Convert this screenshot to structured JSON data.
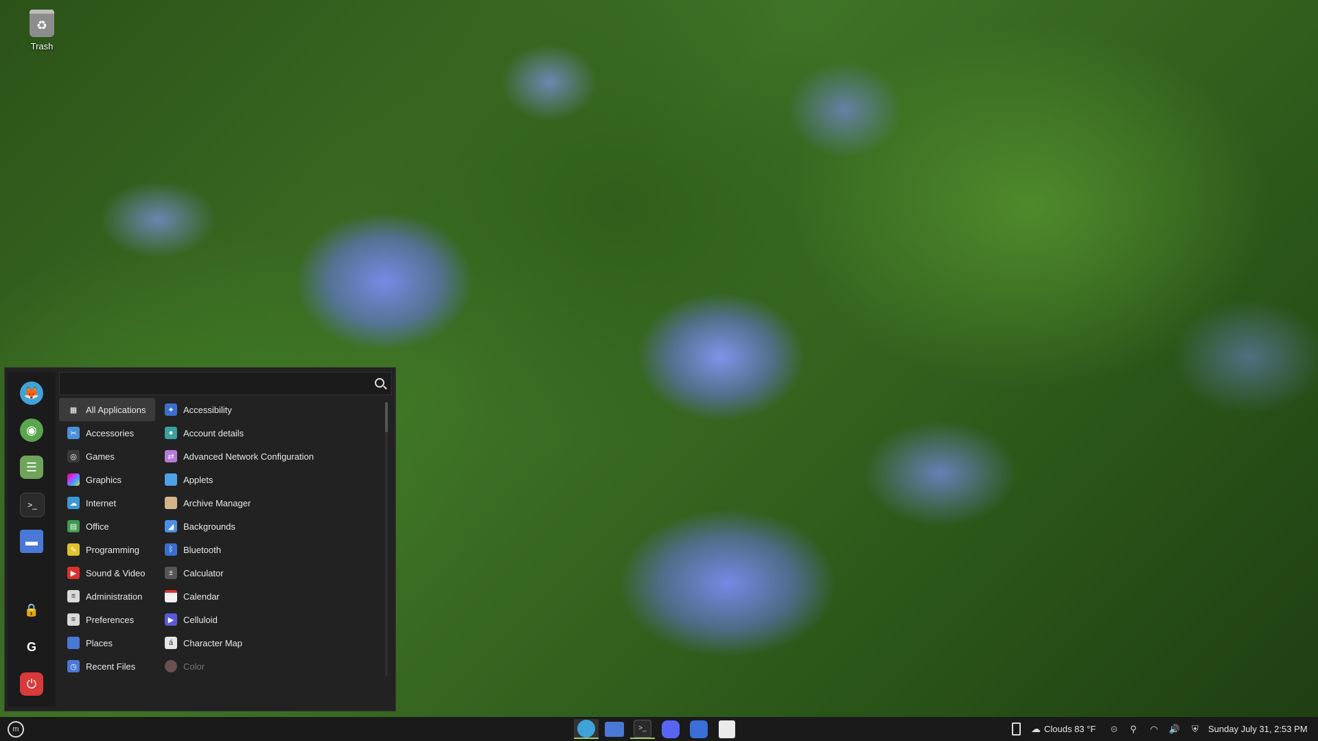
{
  "desktop": {
    "trash_label": "Trash"
  },
  "menu": {
    "search": {
      "value": "",
      "placeholder": ""
    },
    "favorites": [
      {
        "name": "firefox",
        "color": "#3ea3d8"
      },
      {
        "name": "software-manager",
        "color": "#5aa64f"
      },
      {
        "name": "system-settings",
        "color": "#6fa45a"
      },
      {
        "name": "terminal",
        "color": "#2b2b2b"
      },
      {
        "name": "files",
        "color": "#4a78d6"
      },
      {
        "name": "lock-screen",
        "color": "#1b1b1b"
      },
      {
        "name": "logout",
        "color": "#1b1b1b"
      },
      {
        "name": "quit",
        "color": "#d93a3a"
      }
    ],
    "categories": [
      {
        "label": "All Applications",
        "icon": "grid-icon",
        "color": "#3b3b3b"
      },
      {
        "label": "Accessories",
        "icon": "accessories-icon",
        "color": "#4a8fd9"
      },
      {
        "label": "Games",
        "icon": "games-icon",
        "color": "#3a3a3a"
      },
      {
        "label": "Graphics",
        "icon": "graphics-icon",
        "color": "#c43fd1"
      },
      {
        "label": "Internet",
        "icon": "internet-icon",
        "color": "#3a98d8"
      },
      {
        "label": "Office",
        "icon": "office-icon",
        "color": "#3e9a4f"
      },
      {
        "label": "Programming",
        "icon": "programming-icon",
        "color": "#e0c22c"
      },
      {
        "label": "Sound & Video",
        "icon": "sound-video-icon",
        "color": "#d8322f"
      },
      {
        "label": "Administration",
        "icon": "administration-icon",
        "color": "#d9d9d9"
      },
      {
        "label": "Preferences",
        "icon": "preferences-icon",
        "color": "#d9d9d9"
      },
      {
        "label": "Places",
        "icon": "places-icon",
        "color": "#4a78d6"
      },
      {
        "label": "Recent Files",
        "icon": "recent-files-icon",
        "color": "#4a78d6"
      }
    ],
    "applications": [
      {
        "label": "Accessibility",
        "icon": "accessibility-icon",
        "color": "#3a6fd0"
      },
      {
        "label": "Account details",
        "icon": "account-details-icon",
        "color": "#3aa0a0"
      },
      {
        "label": "Advanced Network Configuration",
        "icon": "network-icon",
        "color": "#b57bd8"
      },
      {
        "label": "Applets",
        "icon": "applets-icon",
        "color": "#4ea2e6"
      },
      {
        "label": "Archive Manager",
        "icon": "archive-icon",
        "color": "#d6b48a"
      },
      {
        "label": "Backgrounds",
        "icon": "backgrounds-icon",
        "color": "#4a90e6"
      },
      {
        "label": "Bluetooth",
        "icon": "bluetooth-icon",
        "color": "#3a6fd0"
      },
      {
        "label": "Calculator",
        "icon": "calculator-icon",
        "color": "#555555"
      },
      {
        "label": "Calendar",
        "icon": "calendar-icon",
        "color": "#f2f2f2"
      },
      {
        "label": "Celluloid",
        "icon": "celluloid-icon",
        "color": "#5a5ad8"
      },
      {
        "label": "Character Map",
        "icon": "character-map-icon",
        "color": "#e6e6e6"
      },
      {
        "label": "Color",
        "icon": "color-icon",
        "color": "#6a5050"
      }
    ]
  },
  "taskbar": {
    "apps": [
      "firefox",
      "files",
      "terminal",
      "discord",
      "bitwarden",
      "update-manager"
    ],
    "weather": "Clouds 83 °F",
    "clock": "Sunday July 31, 2:53 PM"
  }
}
